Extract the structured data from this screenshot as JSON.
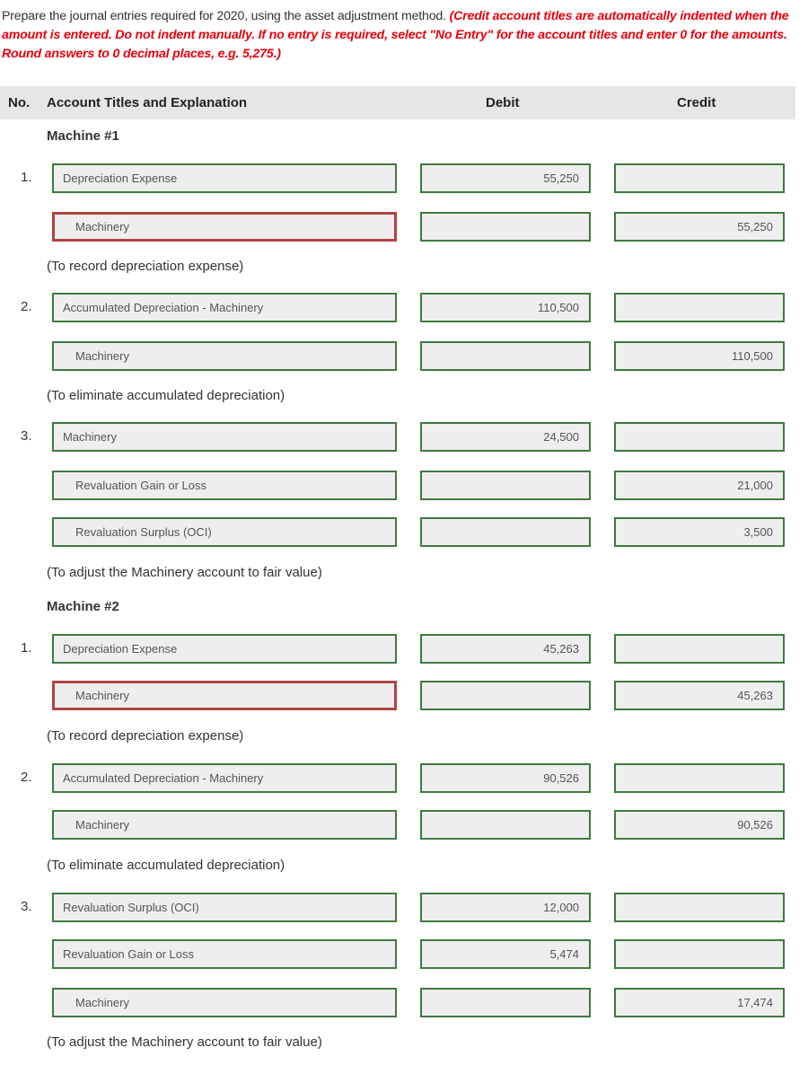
{
  "instructions": {
    "text": "Prepare the journal entries required for 2020, using the asset adjustment method. ",
    "note": "(Credit account titles are automatically indented when the amount is entered. Do not indent manually. If no entry is required, select \"No Entry\" for the account titles and enter 0 for the amounts. Round answers to 0 decimal places, e.g. 5,275.)"
  },
  "header": {
    "no": "No.",
    "account": "Account Titles and Explanation",
    "debit": "Debit",
    "credit": "Credit"
  },
  "sections": [
    {
      "title": "Machine #1",
      "entries": [
        {
          "no": "1.",
          "lines": [
            {
              "account": "Depreciation Expense",
              "debit": "55,250",
              "credit": ""
            },
            {
              "account": "Machinery",
              "debit": "",
              "credit": "55,250"
            }
          ],
          "explanation": "(To record depreciation expense)"
        },
        {
          "no": "2.",
          "lines": [
            {
              "account": "Accumulated Depreciation - Machinery",
              "debit": "110,500",
              "credit": ""
            },
            {
              "account": "Machinery",
              "debit": "",
              "credit": "110,500"
            }
          ],
          "explanation": "(To eliminate accumulated depreciation)"
        },
        {
          "no": "3.",
          "lines": [
            {
              "account": "Machinery",
              "debit": "24,500",
              "credit": ""
            },
            {
              "account": "Revaluation Gain or Loss",
              "debit": "",
              "credit": "21,000"
            },
            {
              "account": "Revaluation Surplus (OCI)",
              "debit": "",
              "credit": "3,500"
            }
          ],
          "explanation": "(To adjust the Machinery account to fair value)"
        }
      ]
    },
    {
      "title": "Machine #2",
      "entries": [
        {
          "no": "1.",
          "lines": [
            {
              "account": "Depreciation Expense",
              "debit": "45,263",
              "credit": ""
            },
            {
              "account": "Machinery",
              "debit": "",
              "credit": "45,263"
            }
          ],
          "explanation": "(To record depreciation expense)"
        },
        {
          "no": "2.",
          "lines": [
            {
              "account": "Accumulated Depreciation - Machinery",
              "debit": "90,526",
              "credit": ""
            },
            {
              "account": "Machinery",
              "debit": "",
              "credit": "90,526"
            }
          ],
          "explanation": "(To eliminate accumulated depreciation)"
        },
        {
          "no": "3.",
          "lines": [
            {
              "account": "Revaluation Surplus (OCI)",
              "debit": "12,000",
              "credit": ""
            },
            {
              "account": "Revaluation Gain or Loss",
              "debit": "5,474",
              "credit": ""
            },
            {
              "account": "Machinery",
              "debit": "",
              "credit": "17,474"
            }
          ],
          "explanation": "(To adjust the Machinery account to fair value)"
        }
      ]
    }
  ],
  "colors": {
    "correct_border": "#3f7a3f",
    "incorrect_border": "#b14444",
    "note_text": "#e8000c",
    "header_bg": "#e6e6e6"
  }
}
